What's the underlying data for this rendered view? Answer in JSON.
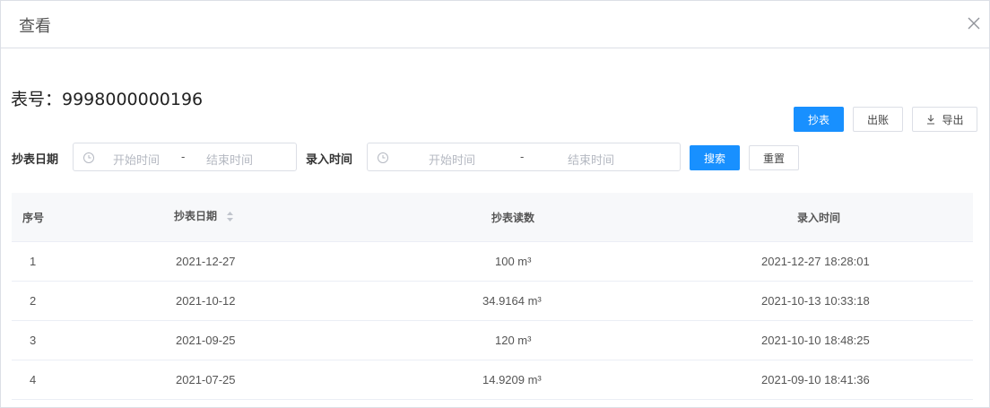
{
  "dialog": {
    "title": "查看",
    "close_icon": "close-icon"
  },
  "meter": {
    "label": "表号：9998000000196"
  },
  "actions": {
    "read_label": "抄表",
    "charge_label": "出账",
    "export_label": "导出",
    "export_icon": "download-icon"
  },
  "filters": {
    "read_date_label": "抄表日期",
    "entry_time_label": "录入时间",
    "start_placeholder": "开始时间",
    "end_placeholder": "结束时间",
    "separator": "-",
    "search_label": "搜索",
    "reset_label": "重置",
    "clock_icon": "clock-icon"
  },
  "table": {
    "columns": [
      "序号",
      "抄表日期",
      "抄表读数",
      "录入时间"
    ],
    "rows": [
      {
        "index": "1",
        "read_date": "2021-12-27",
        "reading": "100 m³",
        "entry_time": "2021-12-27 18:28:01"
      },
      {
        "index": "2",
        "read_date": "2021-10-12",
        "reading": "34.9164 m³",
        "entry_time": "2021-10-13 10:33:18"
      },
      {
        "index": "3",
        "read_date": "2021-09-25",
        "reading": "120 m³",
        "entry_time": "2021-10-10 18:48:25"
      },
      {
        "index": "4",
        "read_date": "2021-07-25",
        "reading": "14.9209 m³",
        "entry_time": "2021-09-10 18:41:36"
      }
    ]
  }
}
